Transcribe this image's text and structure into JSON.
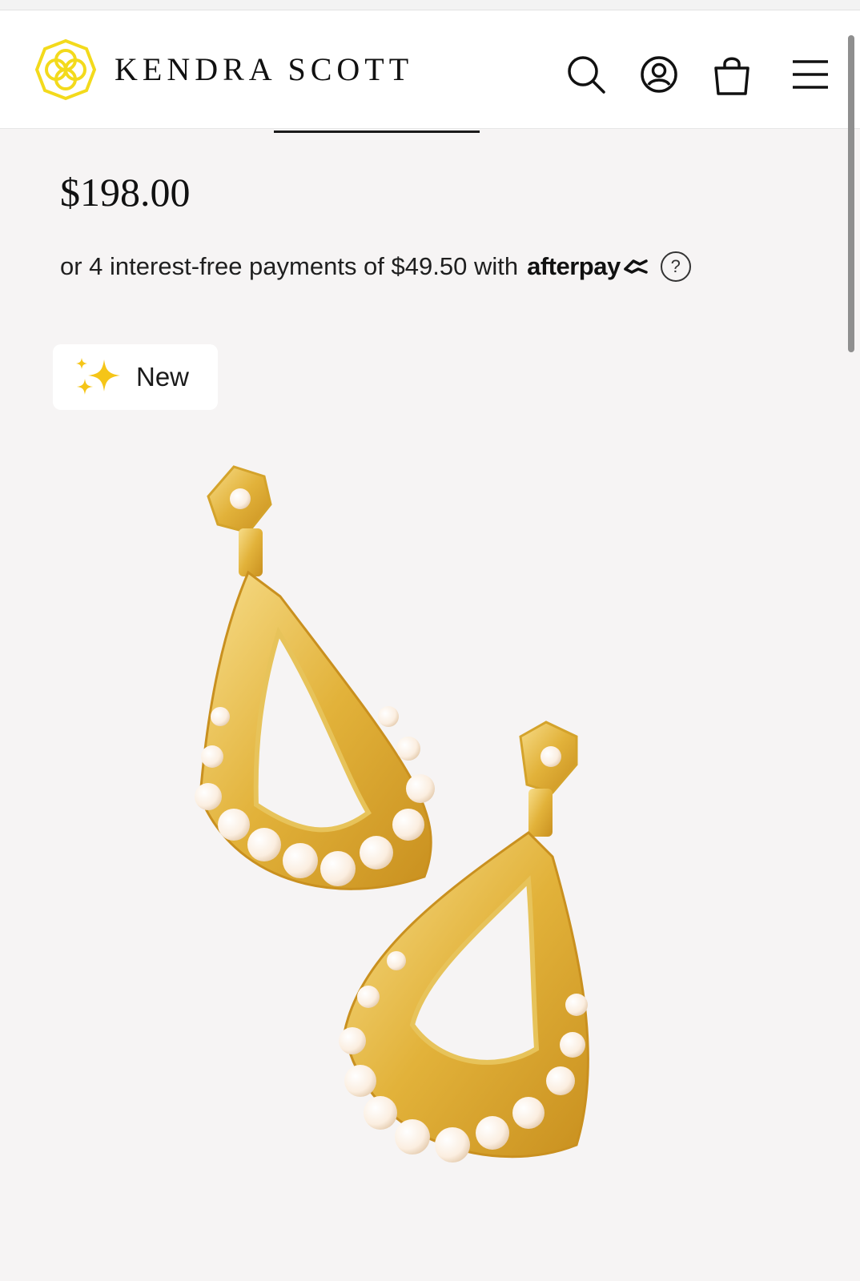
{
  "header": {
    "brand": "KENDRA SCOTT",
    "brand_color": "#f3da1c",
    "logo_icon": "kendra-scott-medallion-icon",
    "icons": [
      "search-icon",
      "account-icon",
      "shopping-bag-icon",
      "hamburger-menu-icon"
    ]
  },
  "product": {
    "price": "$198.00",
    "installment_text": "or 4 interest-free payments of $49.50 with",
    "provider": "afterpay",
    "provider_icon": "afterpay-arrows-icon",
    "help_label": "?",
    "badge": {
      "label": "New",
      "icon": "sparkles-icon",
      "icon_color": "#f5c518"
    },
    "image": {
      "icon": "earrings-image",
      "metal_color": "#e2b23a",
      "pearl_color": "#fbeee0"
    }
  }
}
